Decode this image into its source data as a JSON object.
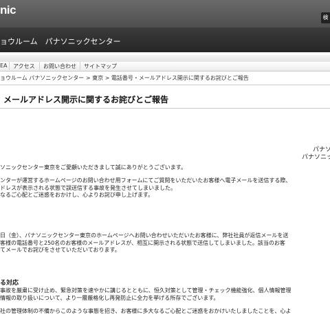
{
  "header": {
    "logo": "nic",
    "side_button": "検"
  },
  "site": {
    "title": "ョウルーム　パナソニックセンター"
  },
  "nav": {
    "items": [
      "EA",
      "アクセス",
      "お問い合わせ",
      "サイトマップ"
    ]
  },
  "breadcrumb": {
    "item1": "ョウルーム パナソニックセンター",
    "sep1": " > ",
    "item2": "東京",
    "sep2": " > ",
    "current": "電話番号・メールアドレス開示に関するお詫びとご報告"
  },
  "article": {
    "title": "メールアドレス開示に関するお詫びとご報告",
    "issuer_line1": "パナソ",
    "issuer_line2": "パナソニッ",
    "greeting": "ソニックセンター東京をご愛顧いただきまして誠にありがとうございます。",
    "para1": [
      "ンターが運営するホームページのお問い合わせ用フォームにてご質問をいただいたお客様へ電子メールを送信する際、",
      "ドレスが表示される状態で誤送信する事故を発生させてしまいました。",
      "なるご心配とご迷惑をおかけし、心よりお詫び申し上げます。"
    ],
    "para2": [
      "日（金）、パナソニックセンター東京のホームページへお問い合わせいただいたお客様に、弊社社員が返信メールを送",
      "客様の電話番号と250名のお客様のメールアドレスが、相互に開示される状態で送信してしまいました。該当のお客",
      "てメールでお詫びをさせていただいております。"
    ],
    "section_heading": "る対応",
    "para3": [
      "事故を厳粛に受け止め、緊急対策を速やかに講じるとともに、恒久対策として管理・チェック機能強化、個人情報管理",
      "情報の取り扱いについて、より一層厳格化し再発防止に全力を挙げる所存でございます。"
    ],
    "closing": "社の管理体制の不備からこのような事態を招き、お客様に多大なるご心配とご迷惑をおかけいたしましたことを、心よ"
  }
}
